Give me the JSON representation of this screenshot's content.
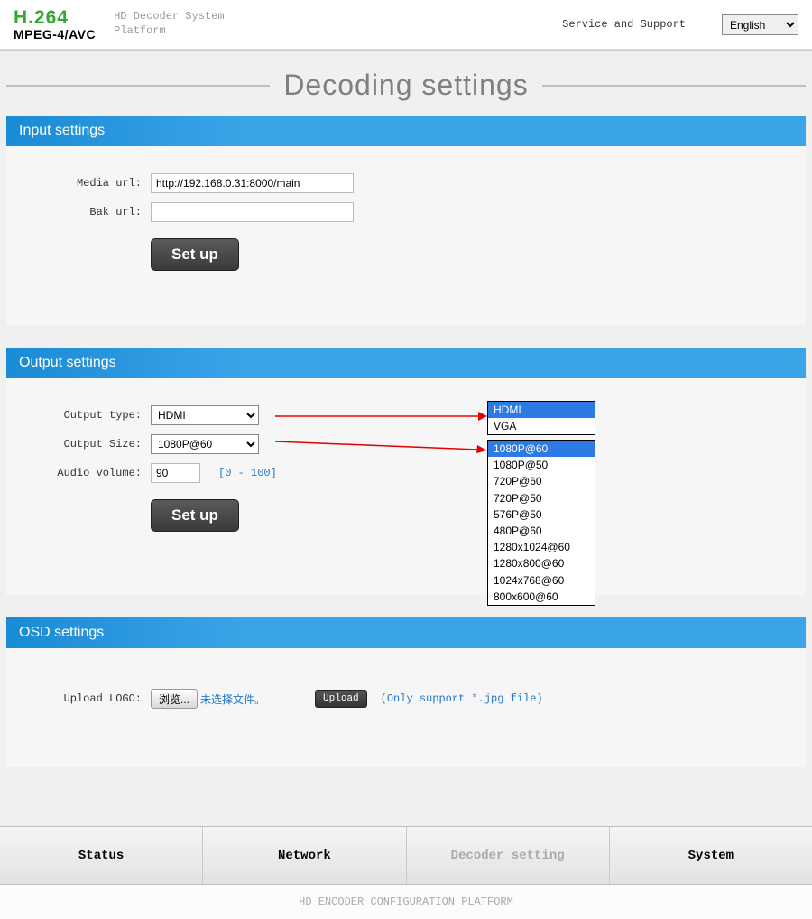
{
  "header": {
    "logo_top": "H.264",
    "logo_bottom": "MPEG-4/AVC",
    "subtitle_line1": "HD Decoder System",
    "subtitle_line2": "Platform",
    "support": "Service and Support",
    "language": "English"
  },
  "page_title": "Decoding  settings",
  "input_section": {
    "title": "Input settings",
    "media_url_label": "Media url:",
    "media_url_value": "http://192.168.0.31:8000/main",
    "bak_url_label": "Bak url:",
    "bak_url_value": "",
    "setup_btn": "Set up"
  },
  "output_section": {
    "title": "Output settings",
    "output_type_label": "Output type:",
    "output_type_value": "HDMI",
    "output_type_options": [
      "HDMI",
      "VGA"
    ],
    "output_size_label": "Output Size:",
    "output_size_value": "1080P@60",
    "output_size_options": [
      "1080P@60",
      "1080P@50",
      "720P@60",
      "720P@50",
      "576P@50",
      "480P@60",
      "1280x1024@60",
      "1280x800@60",
      "1024x768@60",
      "800x600@60"
    ],
    "audio_volume_label": "Audio volume:",
    "audio_volume_value": "90",
    "audio_volume_hint": "[0 - 100]",
    "setup_btn": "Set up"
  },
  "osd_section": {
    "title": "OSD settings",
    "upload_logo_label": "Upload LOGO:",
    "browse_btn": "浏览...",
    "file_status": "未选择文件。",
    "upload_btn": "Upload",
    "file_hint": "(Only support *.jpg file)"
  },
  "nav": {
    "status": "Status",
    "network": "Network",
    "decoder": "Decoder setting",
    "system": "System"
  },
  "footer": "HD ENCODER CONFIGURATION PLATFORM"
}
